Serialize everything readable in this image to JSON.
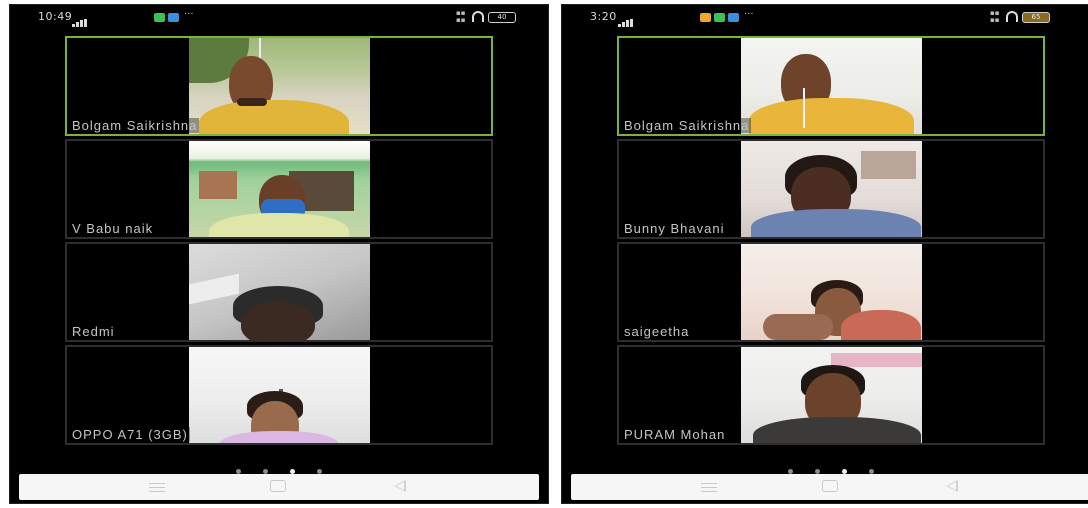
{
  "phones": [
    {
      "status": {
        "time": "10:49",
        "battery": "40"
      },
      "participants": [
        {
          "name": "Bolgam Saikrishna"
        },
        {
          "name": "V Babu naik"
        },
        {
          "name": "Redmi"
        },
        {
          "name": "OPPO A71 (3GB)"
        }
      ],
      "page_dots": {
        "count": 4,
        "active_index": 2
      }
    },
    {
      "status": {
        "time": "3:20",
        "battery": "65"
      },
      "participants": [
        {
          "name": "Bolgam Saikrishna"
        },
        {
          "name": "Bunny Bhavani"
        },
        {
          "name": "saigeetha"
        },
        {
          "name": "PURAM Mohan"
        }
      ],
      "page_dots": {
        "count": 4,
        "active_index": 2
      }
    }
  ],
  "colors": {
    "active_speaker_border": "#7bb33a",
    "tile_border": "#2e2e2e",
    "background": "#000000"
  },
  "icons": [
    "signal-icon",
    "headset-icon",
    "battery-icon",
    "menu-icon",
    "home-icon",
    "back-icon"
  ]
}
